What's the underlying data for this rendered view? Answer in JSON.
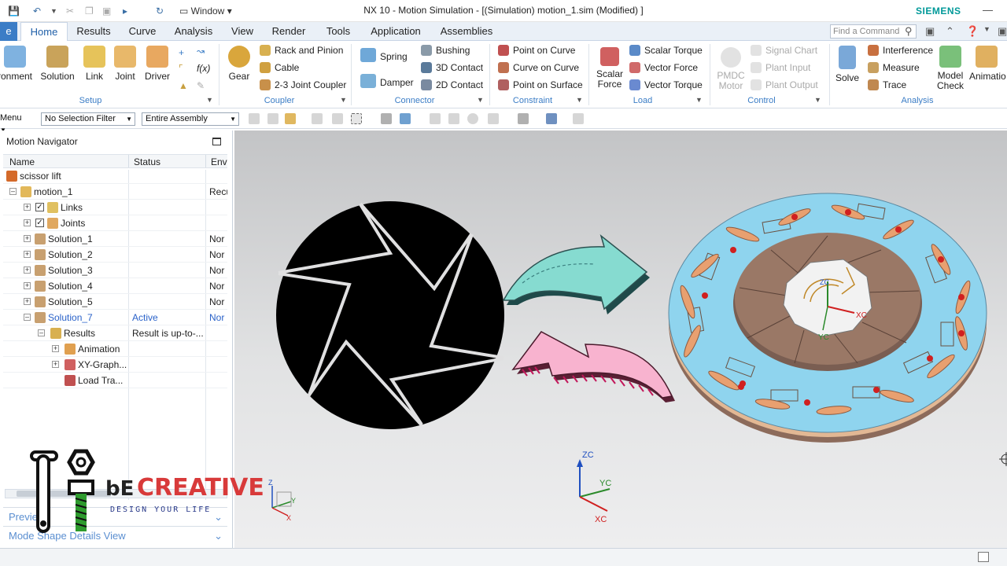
{
  "window": {
    "title": "NX 10 - Motion Simulation - [(Simulation) motion_1.sim (Modified) ]",
    "brand": "SIEMENS",
    "window_menu": "Window"
  },
  "tabs": [
    "Home",
    "Results",
    "Curve",
    "Analysis",
    "View",
    "Render",
    "Tools",
    "Application",
    "Assemblies"
  ],
  "active_tab": "Home",
  "command_finder": {
    "placeholder": "Find a Command"
  },
  "ribbon": {
    "setup": {
      "label": "Setup",
      "buttons": [
        "ronment",
        "Solution",
        "Link",
        "Joint",
        "Driver"
      ]
    },
    "coupler": {
      "label": "Coupler",
      "gear": "Gear",
      "items": [
        "Rack and Pinion",
        "Cable",
        "2-3 Joint Coupler"
      ]
    },
    "connector": {
      "label": "Connector",
      "spring": "Spring",
      "damper": "Damper",
      "items": [
        "Bushing",
        "3D Contact",
        "2D Contact"
      ]
    },
    "constraint": {
      "label": "Constraint",
      "items": [
        "Point on Curve",
        "Curve on Curve",
        "Point on Surface"
      ]
    },
    "load": {
      "label": "Load",
      "scalar_force": [
        "Scalar",
        "Force"
      ],
      "items": [
        "Scalar Torque",
        "Vector Force",
        "Vector Torque"
      ]
    },
    "control": {
      "label": "Control",
      "pmdc": [
        "PMDC",
        "Motor"
      ],
      "items": [
        "Signal Chart",
        "Plant Input",
        "Plant Output"
      ]
    },
    "analysis": {
      "label": "Analysis",
      "solve": "Solve",
      "items": [
        "Interference",
        "Measure",
        "Trace"
      ],
      "model_check": [
        "Model",
        "Check"
      ],
      "animation": "Animatio"
    }
  },
  "toolbar": {
    "menu": "Menu",
    "selection_filter": "No Selection Filter",
    "scope": "Entire Assembly"
  },
  "navigator": {
    "title": "Motion Navigator",
    "columns": [
      "Name",
      "Status",
      "Env"
    ],
    "rows": [
      {
        "name": "scissor lift",
        "status": "",
        "env": ""
      },
      {
        "name": "motion_1",
        "status": "",
        "env": "Recu"
      },
      {
        "name": "Links",
        "status": "",
        "env": ""
      },
      {
        "name": "Joints",
        "status": "",
        "env": ""
      },
      {
        "name": "Solution_1",
        "status": "",
        "env": "Nor"
      },
      {
        "name": "Solution_2",
        "status": "",
        "env": "Nor"
      },
      {
        "name": "Solution_3",
        "status": "",
        "env": "Nor"
      },
      {
        "name": "Solution_4",
        "status": "",
        "env": "Nor"
      },
      {
        "name": "Solution_5",
        "status": "",
        "env": "Nor"
      },
      {
        "name": "Solution_7",
        "status": "Active",
        "env": "Nor"
      },
      {
        "name": "Results",
        "status": "Result is up-to-...",
        "env": ""
      },
      {
        "name": "Animation",
        "status": "",
        "env": ""
      },
      {
        "name": "XY-Graph...",
        "status": "",
        "env": ""
      },
      {
        "name": "Load Tra...",
        "status": "",
        "env": ""
      }
    ],
    "panels": [
      "Preview",
      "Mode Shape Details View"
    ]
  },
  "viewport": {
    "triad_labels": {
      "zc": "ZC",
      "yc": "YC",
      "xc": "XC"
    },
    "small_triad": {
      "z": "Z",
      "y": "Y",
      "x": "X"
    },
    "model_labels": {
      "xc": "XC",
      "yc": "YC",
      "zc": "ZC"
    }
  },
  "watermark": {
    "text": "CREATIVE",
    "prefix": "bE",
    "tagline": "DESIGN YOUR LIFE"
  },
  "colors": {
    "accent": "#3b7dc6",
    "brand": "#009999",
    "teal_arrow": "#7fd6cc",
    "pink_arrow": "#f7a8c8",
    "disc_blue": "#8fd4ee",
    "disc_brown": "#8b6a5c"
  }
}
